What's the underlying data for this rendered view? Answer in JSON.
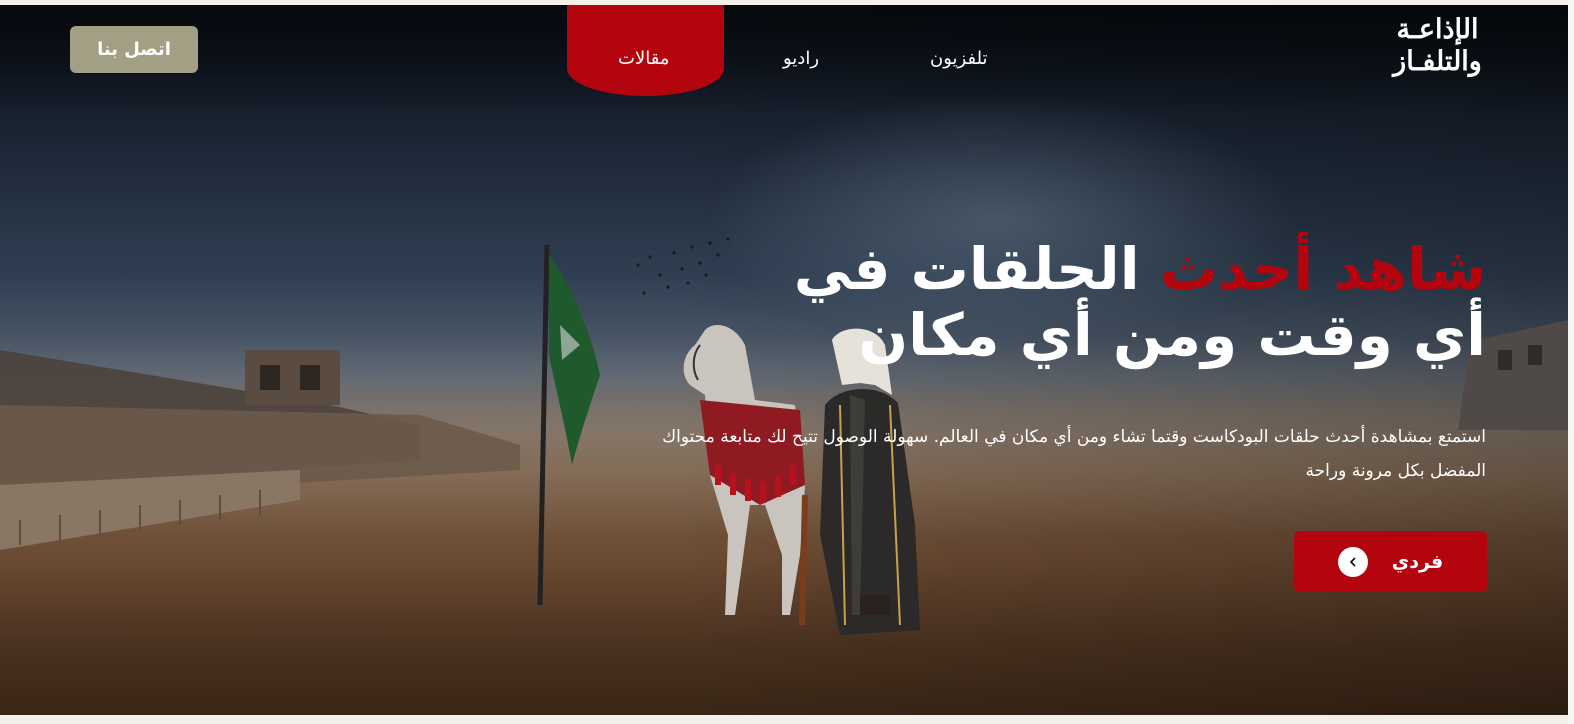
{
  "header": {
    "contact_label": "اتصل بنا",
    "nav": [
      {
        "label": "مقالات",
        "active": true
      },
      {
        "label": "راديو",
        "active": false
      },
      {
        "label": "تلفزيون",
        "active": false
      }
    ],
    "logo": {
      "line1": "الإذاعـة",
      "line2": "والتلفـاز"
    }
  },
  "hero": {
    "headline_accent": "شاهد أحدث",
    "headline_rest": "الحلقات في أي وقت ومن أي مكان",
    "description": "استمتع بمشاهدة أحدث حلقات البودكاست وقتما تشاء ومن أي مكان في العالم. سهولة الوصول تتيح لك متابعة محتواك المفضل بكل مرونة وراحة",
    "cta_label": "فردي",
    "cta_icon": "chevron-left-icon"
  },
  "colors": {
    "accent": "#b4050f",
    "contact_button": "#a29f84",
    "text": "#ffffff"
  }
}
